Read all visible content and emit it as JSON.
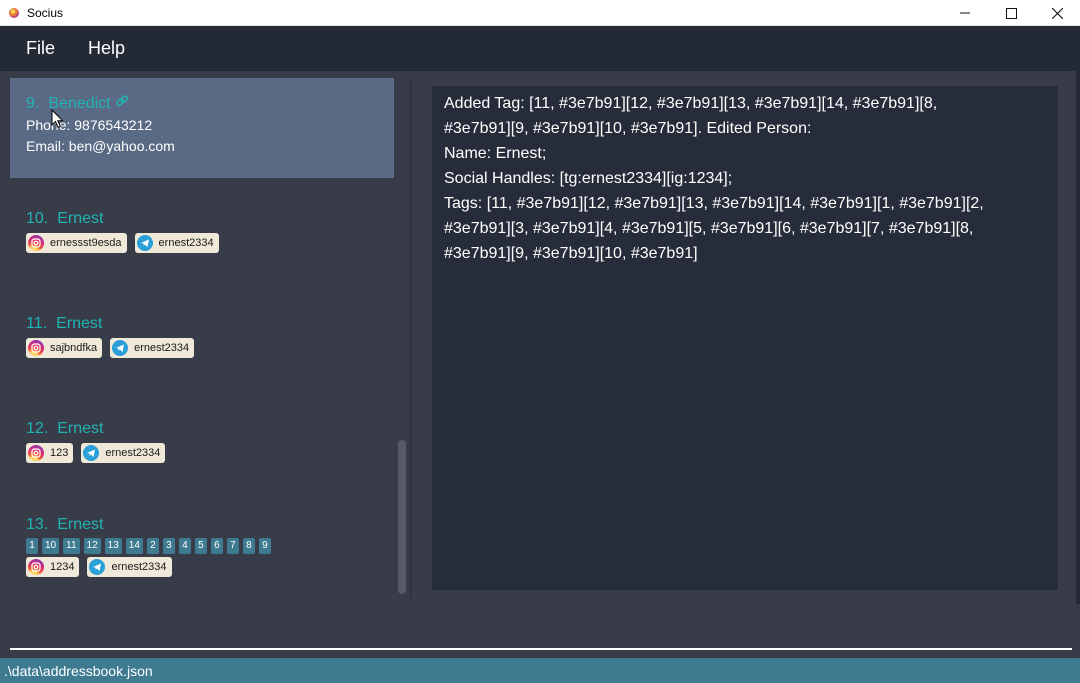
{
  "window": {
    "title": "Socius"
  },
  "menu": {
    "items": [
      {
        "label": "File"
      },
      {
        "label": "Help"
      }
    ]
  },
  "persons": [
    {
      "index": "9.",
      "name": "Benedict",
      "phone": "Phone: 9876543212",
      "email": "Email: ben@yahoo.com",
      "selected": true
    },
    {
      "index": "10.",
      "name": "Ernest",
      "handles": [
        {
          "type": "instagram",
          "value": "ernessst9esda"
        },
        {
          "type": "telegram",
          "value": "ernest2334"
        }
      ]
    },
    {
      "index": "11.",
      "name": "Ernest",
      "handles": [
        {
          "type": "instagram",
          "value": "sajbndfka"
        },
        {
          "type": "telegram",
          "value": "ernest2334"
        }
      ]
    },
    {
      "index": "12.",
      "name": "Ernest",
      "handles": [
        {
          "type": "instagram",
          "value": "123"
        },
        {
          "type": "telegram",
          "value": "ernest2334"
        }
      ]
    },
    {
      "index": "13.",
      "name": "Ernest",
      "tags": [
        "1",
        "10",
        "11",
        "12",
        "13",
        "14",
        "2",
        "3",
        "4",
        "5",
        "6",
        "7",
        "8",
        "9"
      ],
      "handles": [
        {
          "type": "instagram",
          "value": "1234"
        },
        {
          "type": "telegram",
          "value": "ernest2334"
        }
      ]
    }
  ],
  "result": {
    "text": "Added Tag: [11, #3e7b91][12, #3e7b91][13, #3e7b91][14, #3e7b91][8,\n#3e7b91][9, #3e7b91][10, #3e7b91]. Edited Person:\nName: Ernest;\nSocial Handles: [tg:ernest2334][ig:1234];\nTags: [11, #3e7b91][12, #3e7b91][13, #3e7b91][14, #3e7b91][1, #3e7b91][2,\n#3e7b91][3, #3e7b91][4, #3e7b91][5, #3e7b91][6, #3e7b91][7, #3e7b91][8,\n#3e7b91][9, #3e7b91][10, #3e7b91]"
  },
  "command": {
    "value": "",
    "placeholder": ""
  },
  "status": {
    "file_path": ".\\data\\addressbook.json"
  },
  "colors": {
    "accent": "#21b3b3",
    "tag": "#3e7b91",
    "selected": "#5a6a85",
    "background": "#383c48"
  },
  "icons": {
    "app": "socius-icon",
    "link": "link-icon",
    "instagram": "instagram-icon",
    "telegram": "telegram-icon"
  }
}
